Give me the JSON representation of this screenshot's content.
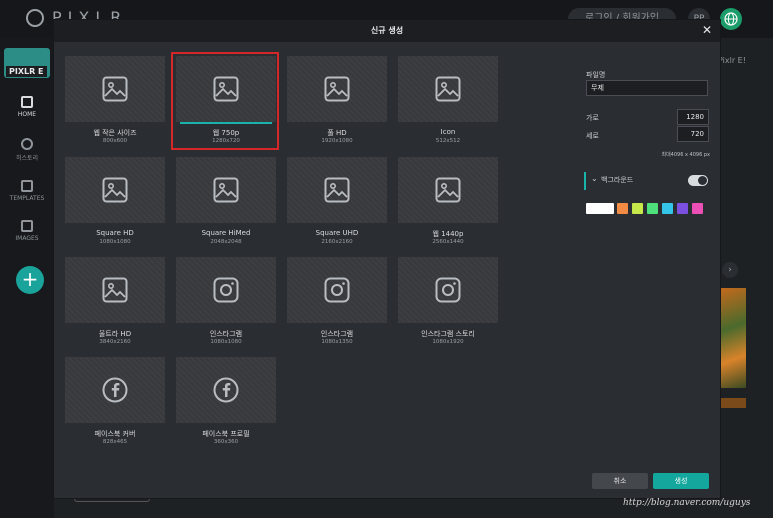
{
  "app": {
    "logo_text": "PIXLR",
    "badge": "PIXLR E",
    "login_text": "로그인 / 회원가입",
    "avatar_text": "PP",
    "right_panel_label": "Pixlr E!"
  },
  "sidebar": {
    "items": [
      {
        "label": "HOME"
      },
      {
        "label": "히스토리"
      },
      {
        "label": "TEMPLATES"
      },
      {
        "label": "IMAGES"
      }
    ],
    "add_label": "+"
  },
  "dialog": {
    "title": "신규 생성",
    "close": "✕",
    "presets": [
      {
        "name": "웹 작은 사이즈",
        "dims": "800x600",
        "icon": "image-icon"
      },
      {
        "name": "웹 750p",
        "dims": "1280x720",
        "icon": "image-icon",
        "selected": true
      },
      {
        "name": "풀 HD",
        "dims": "1920x1080",
        "icon": "image-icon"
      },
      {
        "name": "Icon",
        "dims": "512x512",
        "icon": "image-icon"
      },
      {
        "name": "Square HD",
        "dims": "1080x1080",
        "icon": "image-icon"
      },
      {
        "name": "Square HiMed",
        "dims": "2048x2048",
        "icon": "image-icon"
      },
      {
        "name": "Square UHD",
        "dims": "2160x2160",
        "icon": "image-icon"
      },
      {
        "name": "웹 1440p",
        "dims": "2560x1440",
        "icon": "image-icon"
      },
      {
        "name": "울트라 HD",
        "dims": "3840x2160",
        "icon": "image-icon"
      },
      {
        "name": "인스타그램",
        "dims": "1080x1080",
        "icon": "instagram-icon"
      },
      {
        "name": "인스타그램",
        "dims": "1080x1350",
        "icon": "instagram-icon"
      },
      {
        "name": "인스타그램 스토리",
        "dims": "1080x1920",
        "icon": "instagram-icon"
      },
      {
        "name": "페이스북 커버",
        "dims": "828x465",
        "icon": "facebook-icon"
      },
      {
        "name": "페이스북 프로필",
        "dims": "360x360",
        "icon": "facebook-icon"
      }
    ],
    "panel": {
      "filename_label": "파일명",
      "filename_value": "무제",
      "width_label": "가로",
      "width_value": "1280",
      "height_label": "세로",
      "height_value": "720",
      "max_text": "최대4096 x 4096 px",
      "background_label": "백그라운드",
      "background_enabled": true,
      "swatches": [
        "#ffffff",
        "#f28c45",
        "#c6e84a",
        "#4ee07a",
        "#35c5e8",
        "#7b4fe0",
        "#ec4fb6"
      ]
    },
    "buttons": {
      "cancel": "취소",
      "create": "생성"
    }
  },
  "watermark": "http://blog.naver.com/uguys"
}
